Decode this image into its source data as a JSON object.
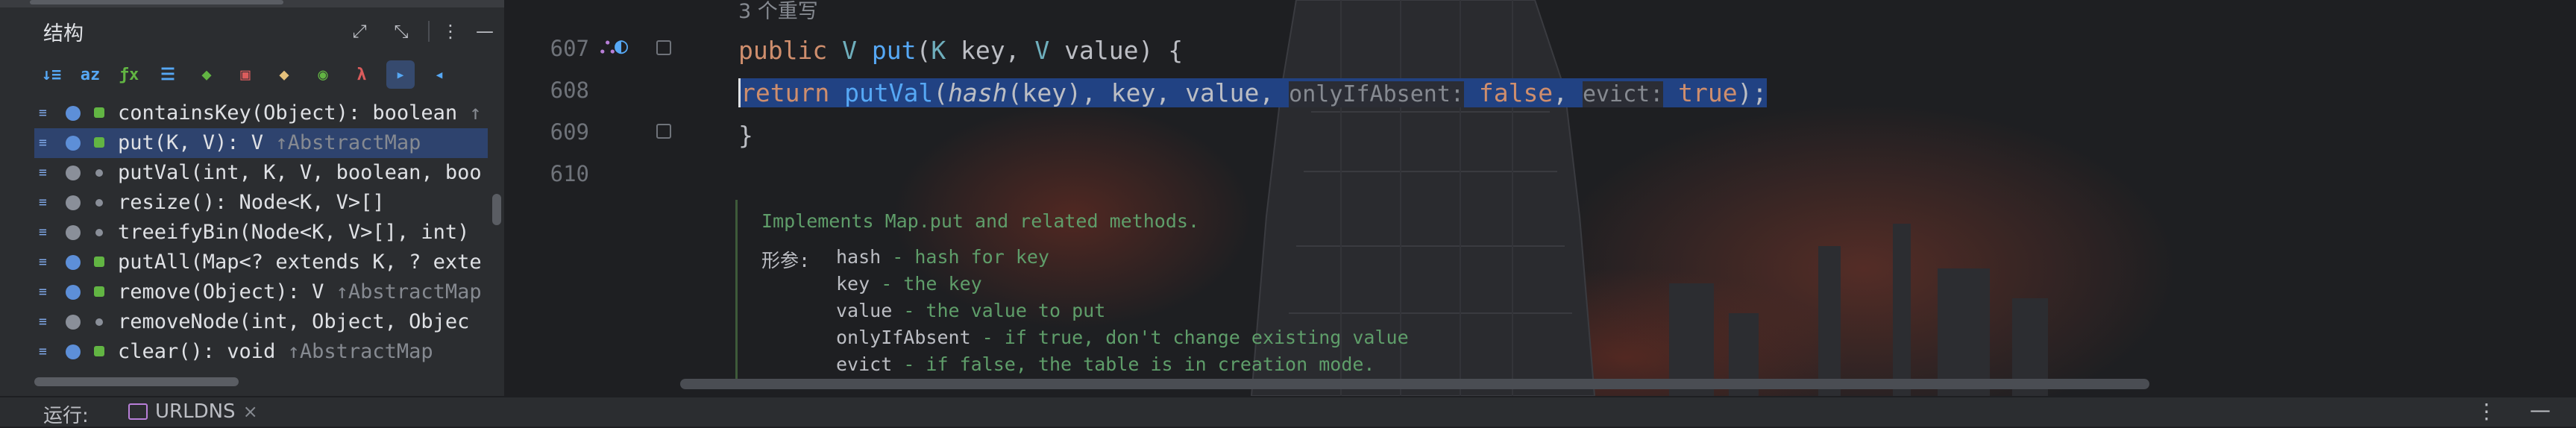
{
  "structure": {
    "title": "结构",
    "toolbar": [
      {
        "glyph": "↓≡",
        "name": "sort-visibility-icon",
        "color": "#56a8f5"
      },
      {
        "glyph": "az",
        "name": "sort-alpha-icon",
        "color": "#56a8f5"
      },
      {
        "glyph": "ƒx",
        "name": "show-fields-icon",
        "color": "#62b543"
      },
      {
        "glyph": "☰",
        "name": "show-properties-icon",
        "color": "#56a8f5"
      },
      {
        "glyph": "◆",
        "name": "show-inherited-icon",
        "color": "#62b543"
      },
      {
        "glyph": "▣",
        "name": "show-non-public-icon",
        "color": "#db5c5c"
      },
      {
        "glyph": "◆",
        "name": "show-anonymous-icon",
        "color": "#e5c07b"
      },
      {
        "glyph": "◉",
        "name": "show-lambdas-icon",
        "color": "#62b543"
      },
      {
        "glyph": "λ",
        "name": "lambda-icon",
        "color": "#db5c5c"
      },
      {
        "glyph": "▸",
        "name": "autoscroll-to-source-icon",
        "color": "#56a8f5",
        "active": true
      },
      {
        "glyph": "◂",
        "name": "autoscroll-from-source-icon",
        "color": "#56a8f5"
      }
    ],
    "items": [
      {
        "sig": "containsKey(Object): boolean ",
        "tail": "↑",
        "visibility": "public"
      },
      {
        "sig": "put(K, V): V ",
        "tail": "↑AbstractMap",
        "visibility": "public",
        "selected": true
      },
      {
        "sig": "putVal(int, K, V, boolean, boo",
        "tail": "",
        "visibility": "package"
      },
      {
        "sig": "resize(): Node<K, V>[]",
        "tail": "",
        "visibility": "package"
      },
      {
        "sig": "treeifyBin(Node<K, V>[], int)",
        "tail": "",
        "visibility": "package"
      },
      {
        "sig": "putAll(Map<? extends K, ? exte",
        "tail": "",
        "visibility": "public"
      },
      {
        "sig": "remove(Object): V ",
        "tail": "↑AbstractMap",
        "visibility": "public"
      },
      {
        "sig": "removeNode(int, Object, Objec",
        "tail": "",
        "visibility": "package"
      },
      {
        "sig": "clear(): void ",
        "tail": "↑AbstractMap",
        "visibility": "public"
      }
    ]
  },
  "editor": {
    "overrides_hint": "3 个重写",
    "line_numbers": [
      "607",
      "608",
      "609",
      "610"
    ],
    "line607": {
      "kw": "public ",
      "type": "V ",
      "fn": "put",
      "rest1": "(",
      "type2": "K",
      "rest2": " key, ",
      "type3": "V",
      "rest3": " value) {"
    },
    "line608": {
      "kw": "return ",
      "fn": "putVal",
      "p1": "(",
      "it": "hash",
      "p2": "(key)",
      "p3": ", key, value, ",
      "hint1": "onlyIfAbsent:",
      "val1": " false",
      "p4": ", ",
      "hint2": "evict:",
      "val2": " true",
      "p5": ");"
    },
    "line609": "}",
    "doc": {
      "summary": "Implements Map.put and related methods.",
      "params_label": "形参:",
      "params": [
        {
          "name": "hash",
          "desc": " - hash for key"
        },
        {
          "name": "key",
          "desc": " - the key"
        },
        {
          "name": "value",
          "desc": " - the value to put"
        },
        {
          "name": "onlyIfAbsent",
          "desc": " - if true, don't change existing value"
        },
        {
          "name": "evict",
          "desc": " - if false, the table is in creation mode."
        }
      ]
    }
  },
  "runbar": {
    "label": "运行:",
    "tab": "URLDNS",
    "close": "×",
    "more": "⋮",
    "minimize": "—"
  }
}
